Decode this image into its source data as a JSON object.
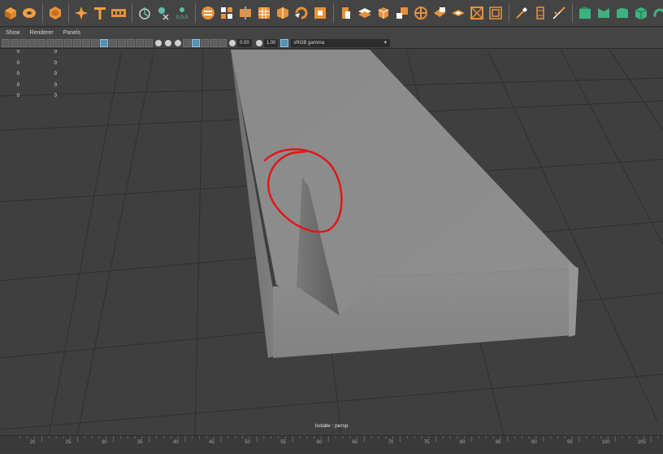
{
  "menubar": {
    "items": [
      "Show",
      "Renderer",
      "Panels"
    ]
  },
  "panel_toolbar": {
    "exposure_value": "0.00",
    "gamma_value": "1.00",
    "color_space": "sRGB gamma"
  },
  "hud": {
    "rows": [
      {
        "a": "0",
        "b": "0"
      },
      {
        "a": "0",
        "b": "0"
      },
      {
        "a": "0",
        "b": "0"
      },
      {
        "a": "0",
        "b": "0"
      },
      {
        "a": "0",
        "b": "0"
      }
    ]
  },
  "viewport": {
    "camera_label": "Isolate : persp"
  },
  "timeline": {
    "ticks": [
      "20",
      "25",
      "30",
      "35",
      "40",
      "45",
      "50",
      "55",
      "60",
      "65",
      "70",
      "75",
      "80",
      "85",
      "90",
      "95",
      "100",
      "105"
    ]
  },
  "shelf": {
    "icons": [
      "polygon-cube-icon",
      "cylinder-icon",
      "sphere-icon",
      "sweep-mesh-icon",
      "type-icon",
      "svg-icon",
      "super-shape-icon",
      "uv-icon",
      "display-coords-icon",
      "combine-icon",
      "separate-icon",
      "mirror-icon",
      "smooth-icon",
      "reduce-icon",
      "cleanup-icon",
      "fill-hole-icon",
      "extrude-icon",
      "bridge-icon",
      "bevel-icon",
      "append-icon",
      "multicut-icon",
      "insert-edgeloop-icon",
      "offset-edgeloop-icon",
      "merge-icon",
      "circularize-icon",
      "target-weld-icon",
      "poke-icon",
      "wedge-icon",
      "normals-icon",
      "reverse-icon",
      "soften-edge-icon",
      "harden-edge-icon",
      "conform-icon"
    ]
  },
  "colors": {
    "accent": "#e8913a",
    "teal": "#5fbfa5",
    "viewport_bg": "#3f3f3f",
    "annotation": "#e01818"
  }
}
